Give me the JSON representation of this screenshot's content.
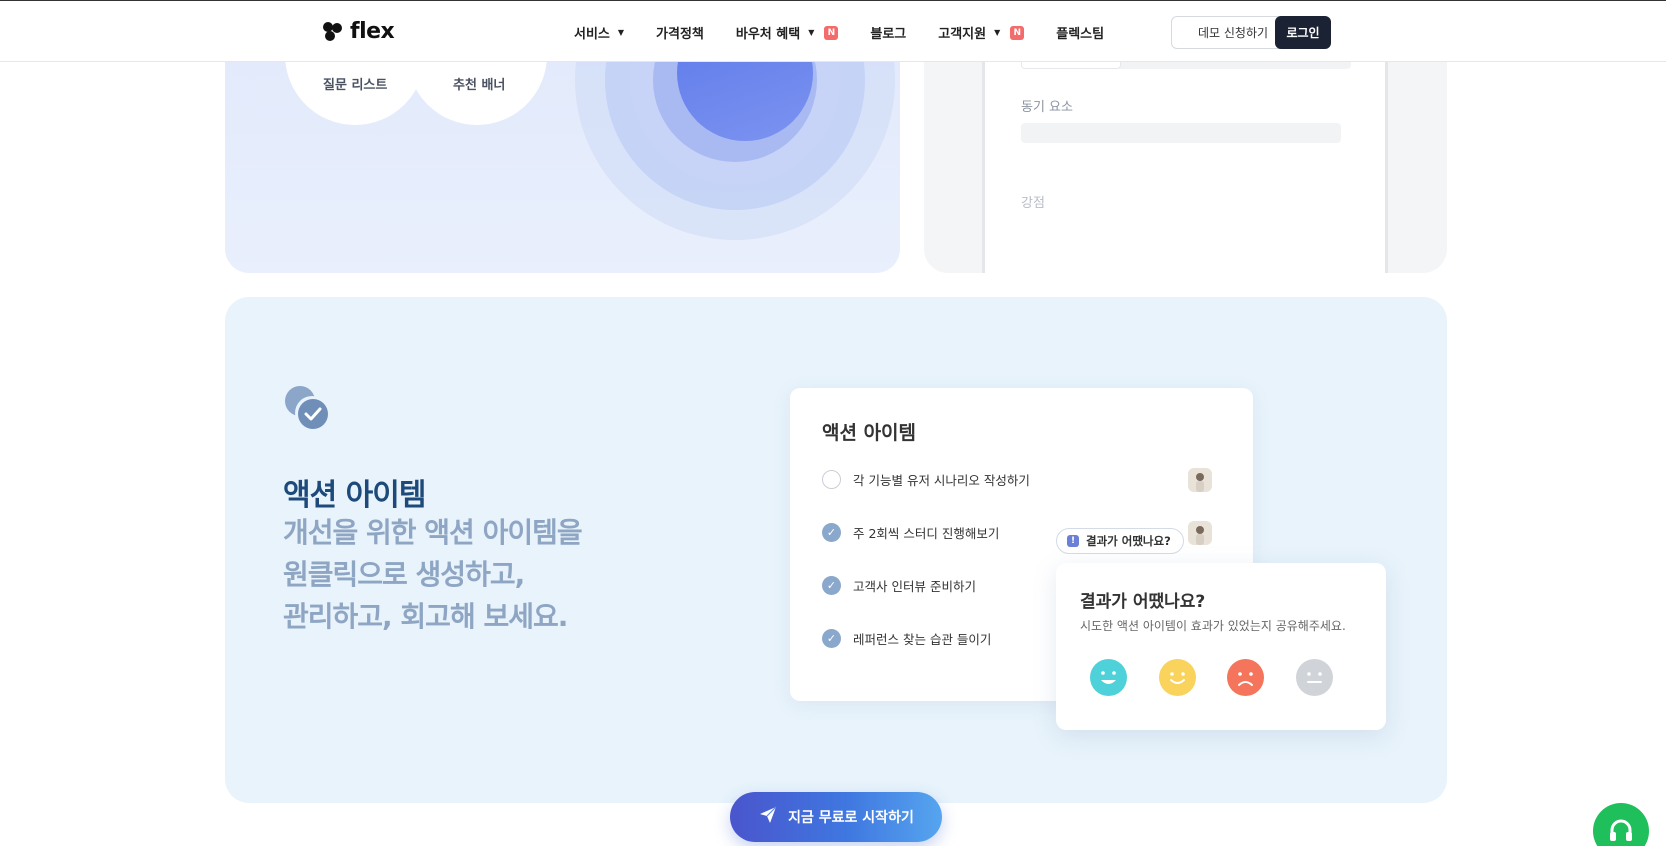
{
  "header": {
    "logo_text": "flex",
    "nav": [
      {
        "label": "서비스",
        "has_caret": true,
        "badge": ""
      },
      {
        "label": "가격정책",
        "has_caret": false,
        "badge": ""
      },
      {
        "label": "바우처 혜택",
        "has_caret": true,
        "badge": "N"
      },
      {
        "label": "블로그",
        "has_caret": false,
        "badge": ""
      },
      {
        "label": "고객지원",
        "has_caret": true,
        "badge": "N"
      },
      {
        "label": "플렉스팀",
        "has_caret": false,
        "badge": ""
      }
    ],
    "demo_label": "데모 신청하기",
    "login_label": "로그인"
  },
  "top_left": {
    "bubble1_label": "질문 리스트",
    "bubble2_label": "추천 배너"
  },
  "top_right": {
    "field1_label": "동기 요소",
    "field2_label": "강점"
  },
  "action": {
    "title": "액션 아이템",
    "desc_lines": [
      "개선을 위한 액션 아이템을",
      "원클릭으로 생성하고,",
      "관리하고, 회고해 보세요."
    ],
    "card_title": "액션 아이템",
    "items": [
      {
        "label": "각 기능별 유저 시나리오 작성하기",
        "done": false
      },
      {
        "label": "주 2회씩 스터디 진행해보기",
        "done": true
      },
      {
        "label": "고객사 인터뷰 준비하기",
        "done": true
      },
      {
        "label": "레퍼런스 찾는 습관 들이기",
        "done": true
      }
    ],
    "pill_label": "결과가 어땠나요?",
    "popup_title": "결과가 어땠나요?",
    "popup_desc": "시도한 액션 아이템이 효과가 있었는지 공유해주세요.",
    "emojis": [
      "very-happy",
      "happy",
      "sad",
      "neutral"
    ]
  },
  "cta_label": "지금 무료로 시작하기",
  "colors": {
    "accent": "#1d4a7a",
    "cta_start": "#4a55cc",
    "cta_end": "#56a5ef",
    "support": "#1fbf5b"
  }
}
